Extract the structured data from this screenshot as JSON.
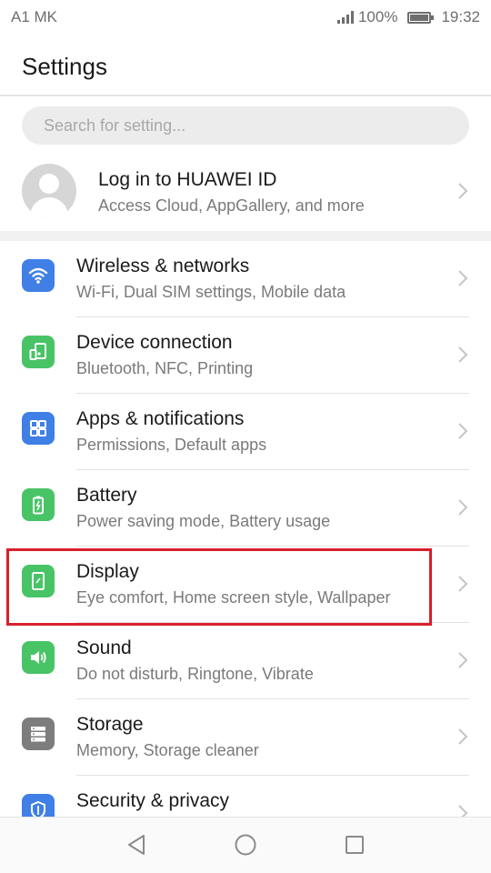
{
  "status_bar": {
    "carrier": "A1 MK",
    "battery": "100%",
    "time": "19:32"
  },
  "header": {
    "title": "Settings"
  },
  "search": {
    "placeholder": "Search for setting..."
  },
  "account": {
    "title": "Log in to HUAWEI ID",
    "subtitle": "Access Cloud, AppGallery, and more"
  },
  "items": [
    {
      "title": "Wireless & networks",
      "subtitle": "Wi-Fi, Dual SIM settings, Mobile data",
      "icon": "wifi-icon",
      "color": "#3f7fe6"
    },
    {
      "title": "Device connection",
      "subtitle": "Bluetooth, NFC, Printing",
      "icon": "device-connection-icon",
      "color": "#48c466"
    },
    {
      "title": "Apps & notifications",
      "subtitle": "Permissions, Default apps",
      "icon": "apps-grid-icon",
      "color": "#3f7fe6"
    },
    {
      "title": "Battery",
      "subtitle": "Power saving mode, Battery usage",
      "icon": "battery-icon",
      "color": "#48c466"
    },
    {
      "title": "Display",
      "subtitle": "Eye comfort, Home screen style, Wallpaper",
      "icon": "display-icon",
      "color": "#48c466"
    },
    {
      "title": "Sound",
      "subtitle": "Do not disturb, Ringtone, Vibrate",
      "icon": "speaker-icon",
      "color": "#48c466"
    },
    {
      "title": "Storage",
      "subtitle": "Memory, Storage cleaner",
      "icon": "storage-icon",
      "color": "#7d7d7d"
    },
    {
      "title": "Security & privacy",
      "subtitle": "",
      "icon": "shield-icon",
      "color": "#3f7fe6"
    }
  ],
  "highlighted_item": "Display",
  "colors": {
    "highlight_border": "#d9202d",
    "blue_icon": "#3f7fe6",
    "green_icon": "#48c466",
    "gray_icon": "#7d7d7d"
  },
  "nav_bar": {
    "back": "back-icon",
    "home": "home-icon",
    "recents": "recents-icon"
  }
}
